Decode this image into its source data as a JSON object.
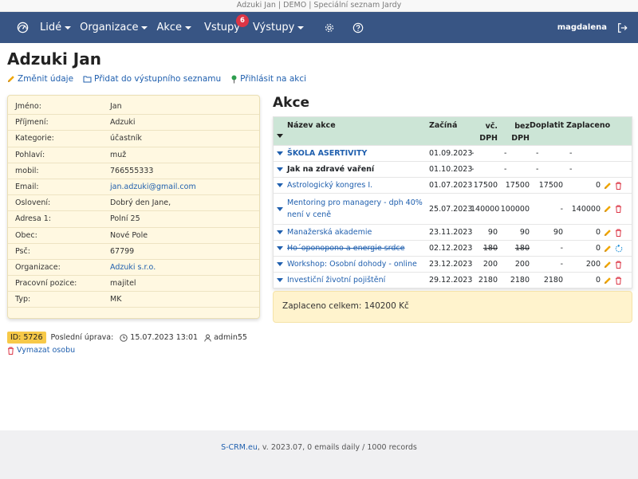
{
  "window": {
    "title": "Adzuki Jan | DEMO | Speciální seznam Jardy"
  },
  "nav": {
    "items": [
      {
        "label": "Lidé",
        "dropdown": true
      },
      {
        "label": "Organizace",
        "dropdown": true
      },
      {
        "label": "Akce",
        "dropdown": true
      }
    ],
    "vstupy": {
      "label": "Vstupy",
      "badge": "6"
    },
    "vystupy": {
      "label": "Výstupy"
    },
    "user": "magdalena",
    "icons": [
      "dashboard-icon",
      "gear-icon",
      "help-icon",
      "logout-icon"
    ],
    "colors": {
      "navbar": "#385584",
      "badge": "#dc3545"
    }
  },
  "page": {
    "title": "Adzuki Jan",
    "actions": {
      "edit": "Změnit údaje",
      "add_output": "Přidat do výstupního seznamu",
      "register": "Přihlásit na akci"
    }
  },
  "person": {
    "rows": [
      {
        "label": "Jméno:",
        "value": "Jan"
      },
      {
        "label": "Příjmení:",
        "value": "Adzuki"
      },
      {
        "label": "Kategorie:",
        "value": "účastník"
      },
      {
        "label": "Pohlaví:",
        "value": "muž"
      },
      {
        "label": "mobil:",
        "value": "766555333"
      },
      {
        "label": "Email:",
        "value": "jan.adzuki@gmail.com",
        "link": true
      },
      {
        "label": "Oslovení:",
        "value": "Dobrý den Jane,"
      },
      {
        "label": "Adresa 1:",
        "value": "Polní 25"
      },
      {
        "label": "Obec:",
        "value": "Nové Pole"
      },
      {
        "label": "Psč:",
        "value": "67799"
      },
      {
        "label": "Organizace:",
        "value": "Adzuki s.r.o.",
        "link": true
      },
      {
        "label": "Pracovní pozice:",
        "value": "majitel"
      },
      {
        "label": "Typ:",
        "value": "MK"
      }
    ]
  },
  "akce": {
    "title": "Akce",
    "headers": {
      "name": "Název akce",
      "date": "Začíná",
      "vc1": "vč.",
      "vc2": "DPH",
      "bez1": "bez",
      "bez2": "DPH",
      "doplatit": "Doplatit",
      "zaplaceno": "Zaplaceno"
    },
    "rows": [
      {
        "name": "ŠKOLA ASERTIVITY",
        "style": "bold-link",
        "date": "01.09.2023",
        "vc": "-",
        "bez": "-",
        "dop": "-",
        "zap": "-",
        "actions": []
      },
      {
        "name": "Jak na zdravé vaření",
        "style": "bold",
        "date": "01.10.2023",
        "vc": "-",
        "bez": "-",
        "dop": "-",
        "zap": "-",
        "actions": []
      },
      {
        "name": "Astrologický kongres I.",
        "style": "link",
        "date": "01.07.2023",
        "vc": "17500",
        "bez": "17500",
        "dop": "17500",
        "zap": "0",
        "actions": [
          "pencil-icon",
          "trash-icon"
        ]
      },
      {
        "name": "Mentoring pro managery - dph 40% není v ceně",
        "style": "link",
        "date": "25.07.2023",
        "vc": "140000",
        "bez": "100000",
        "dop": "-",
        "zap": "140000",
        "actions": [
          "pencil-icon",
          "trash-icon"
        ]
      },
      {
        "name": "Manažerská akademie",
        "style": "link",
        "date": "23.11.2023",
        "vc": "90",
        "bez": "90",
        "dop": "90",
        "zap": "0",
        "actions": [
          "pencil-icon",
          "trash-icon"
        ]
      },
      {
        "name": "Ho´oponopono a energie srdce",
        "style": "strike",
        "date": "02.12.2023",
        "vc": "180",
        "bez": "180",
        "dop": "-",
        "zap": "0",
        "strike_prices": true,
        "actions": [
          "pencil-icon",
          "restore-icon"
        ]
      },
      {
        "name": "Workshop: Osobní dohody - online",
        "style": "link",
        "date": "23.12.2023",
        "vc": "200",
        "bez": "200",
        "dop": "-",
        "zap": "200",
        "actions": [
          "pencil-icon",
          "trash-icon"
        ]
      },
      {
        "name": "Investiční životní pojištění",
        "style": "link",
        "date": "29.12.2023",
        "vc": "2180",
        "bez": "2180",
        "dop": "2180",
        "zap": "0",
        "actions": [
          "pencil-icon",
          "trash-icon"
        ]
      }
    ],
    "total": "Zaplaceno celkem: 140200 Kč",
    "colors": {
      "header_bg": "#cce5d6",
      "total_bg": "#fff3cd"
    }
  },
  "meta": {
    "id": "ID: 5726",
    "last_edit_label": "Poslední úprava:",
    "last_edit_time": "15.07.2023 13:01",
    "last_edit_user": "admin55",
    "delete": "Vymazat osobu"
  },
  "footer": {
    "link": "S-CRM.eu",
    "text": ", v. 2023.07, 0 emails daily / 1000 records"
  }
}
